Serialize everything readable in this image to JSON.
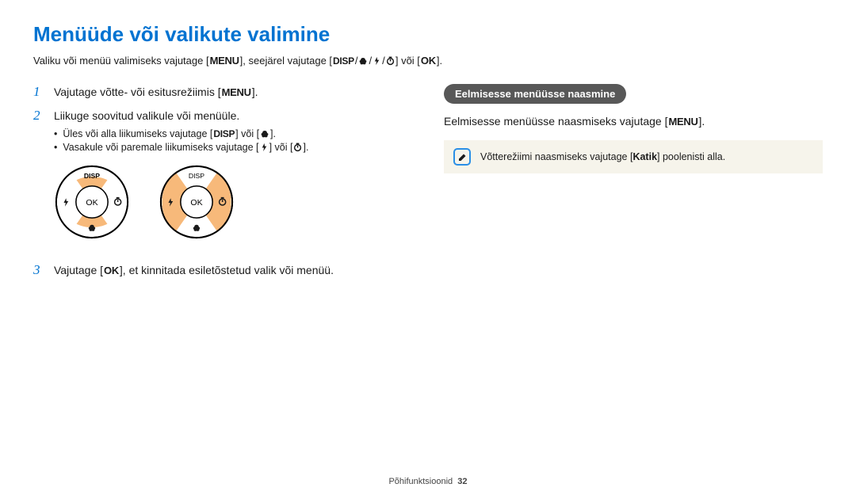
{
  "heading": "Menüüde või valikute valimine",
  "intro": {
    "p1": "Valiku või menüü valimiseks vajutage [",
    "p2": "], seejärel vajutage [",
    "p3": "] või [",
    "p4": "]."
  },
  "steps": {
    "s1": {
      "num": "1",
      "p1": "Vajutage võtte- või esitusrežiimis [",
      "p2": "]."
    },
    "s2": {
      "num": "2",
      "text": "Liikuge soovitud valikule või menüüle.",
      "sub1": {
        "p1": "Üles või alla liikumiseks vajutage [",
        "p2": "] või [",
        "p3": "]."
      },
      "sub2": {
        "p1": "Vasakule või paremale liikumiseks vajutage [",
        "p2": "] või [",
        "p3": "]."
      }
    },
    "s3": {
      "num": "3",
      "p1": "Vajutage [",
      "p2": "], et kinnitada esiletõstetud valik või menüü."
    }
  },
  "right": {
    "pill": "Eelmisesse menüüsse naasmine",
    "text_p1": "Eelmisesse menüüsse naasmiseks vajutage [",
    "text_p2": "].",
    "note_p1": "Võtterežiimi naasmiseks vajutage [",
    "note_bold": "Katik",
    "note_p2": "] poolenisti alla."
  },
  "dial": {
    "disp": "DISP",
    "ok": "OK"
  },
  "footer": {
    "label": "Põhifunktsioonid",
    "page": "32"
  },
  "icons": {
    "menu": "MENU",
    "disp": "DISP",
    "ok": "OK"
  }
}
